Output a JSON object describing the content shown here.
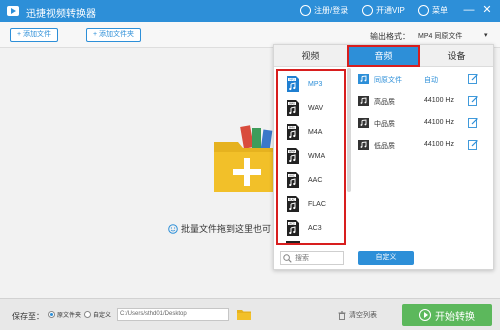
{
  "window": {
    "title": "迅捷视频转换器",
    "login": "注册/登录",
    "vip": "开通VIP",
    "menu": "菜单",
    "minimize": "—",
    "close": "✕"
  },
  "toolbar": {
    "add_file": "+ 添加文件",
    "add_folder": "+ 添加文件夹",
    "format_label": "输出格式：",
    "format_value": "MP4  同原文件",
    "format_caret": "▾"
  },
  "droparea": {
    "hint": "批量文件拖到这里也可"
  },
  "popup": {
    "tabs": [
      {
        "label": "视频"
      },
      {
        "label": "音频"
      },
      {
        "label": "设备"
      }
    ],
    "active_tab": "音频",
    "formats": [
      {
        "name": "MP3",
        "icon": "mp3-file-icon"
      },
      {
        "name": "WAV",
        "icon": "wav-file-icon"
      },
      {
        "name": "M4A",
        "icon": "m4a-file-icon"
      },
      {
        "name": "WMA",
        "icon": "wma-file-icon"
      },
      {
        "name": "AAC",
        "icon": "aac-file-icon"
      },
      {
        "name": "FLAC",
        "icon": "flac-file-icon"
      },
      {
        "name": "AC3",
        "icon": "ac3-file-icon"
      }
    ],
    "qualities": [
      {
        "name": "同原文件",
        "rate": "自动"
      },
      {
        "name": "高品质",
        "rate": "44100 Hz"
      },
      {
        "name": "中品质",
        "rate": "44100 Hz"
      },
      {
        "name": "低品质",
        "rate": "44100 Hz"
      }
    ],
    "search_placeholder": "搜索",
    "custom": "自定义"
  },
  "bottom": {
    "save_to": "保存至：",
    "option_original": "原文件夹",
    "option_custom": "自定义",
    "path": "C:/Users/sthd01/Desktop",
    "clear_list": "清空列表",
    "start": "开始转换"
  },
  "colors": {
    "accent": "#2d8fd8",
    "highlight_border": "#d81e1e",
    "start_button": "#5cb85c",
    "folder_yellow": "#f2c029"
  }
}
